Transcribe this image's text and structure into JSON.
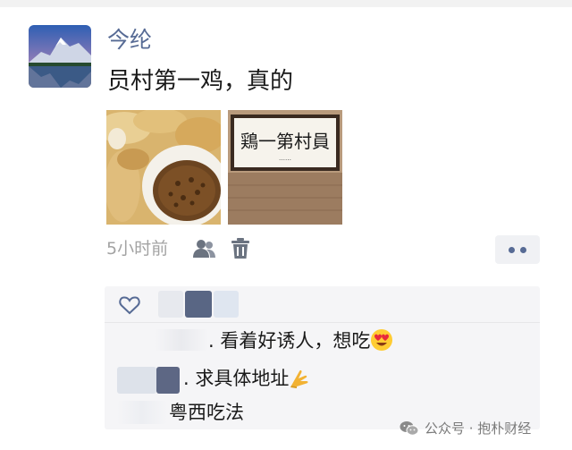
{
  "post": {
    "username": "今纶",
    "text": "员村第一鸡，真的",
    "time": "5小时前",
    "photos": [
      {
        "icon": "food-photo",
        "description_icon": "chicken-dish-photo"
      },
      {
        "icon": "sign-photo",
        "sign_text": "鶏一第村員",
        "sign_small": "……"
      }
    ]
  },
  "comments": [
    {
      "text": "看着好诱人，想吃",
      "emoji": "heart-eyes-emoji"
    },
    {
      "text": "求具体地址",
      "emoji": "folded-hands-emoji"
    },
    {
      "text": "粤西吃法"
    }
  ],
  "watermark": {
    "text": "公众号 · 抱朴财经"
  },
  "colors": {
    "name": "#576b95",
    "meta": "#a3a3a3",
    "comment_bg": "#f5f5f7"
  }
}
